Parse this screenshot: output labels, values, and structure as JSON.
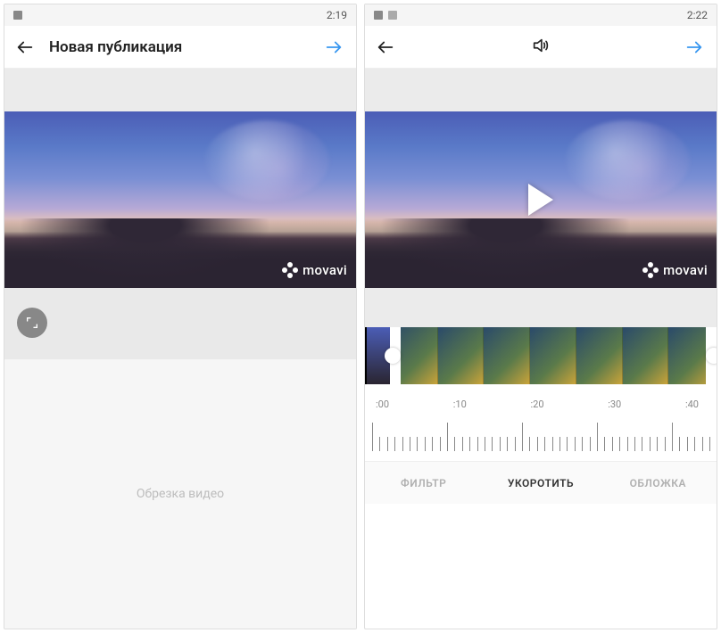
{
  "left": {
    "statusbar": {
      "time": "2:19"
    },
    "topbar": {
      "title": "Новая публикация"
    },
    "watermark": "movavi",
    "bottom_text": "Обрезка видео"
  },
  "right": {
    "statusbar": {
      "time": "2:22"
    },
    "watermark": "movavi",
    "ruler": {
      "labels": [
        ":00",
        ":10",
        ":20",
        ":30",
        ":40"
      ]
    },
    "tabs": {
      "filter": "ФИЛЬТР",
      "trim": "УКОРОТИТЬ",
      "cover": "ОБЛОЖКА",
      "active": "trim"
    }
  }
}
